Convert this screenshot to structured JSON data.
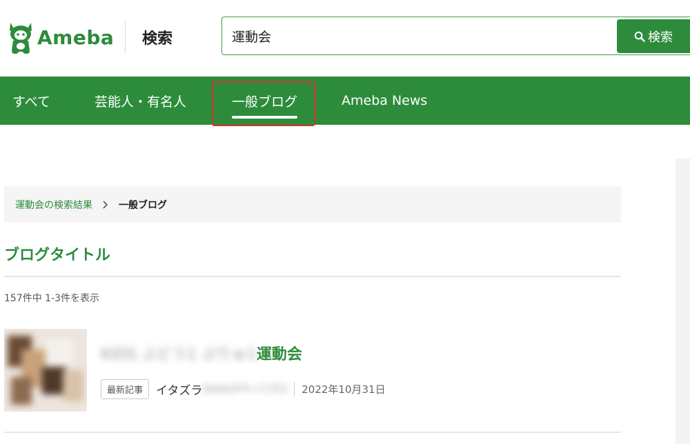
{
  "header": {
    "logo_text": "Ameba",
    "search_label": "検索",
    "search_value": "運動会",
    "search_button_label": "検索"
  },
  "nav": {
    "tabs": [
      {
        "label": "すべて"
      },
      {
        "label": "芸能人・有名人"
      },
      {
        "label": "一般ブログ",
        "active": true
      },
      {
        "label": "Ameba News"
      }
    ]
  },
  "breadcrumb": {
    "link": "運動会の検索結果",
    "current": "一般ブログ"
  },
  "section": {
    "title": "ブログタイトル",
    "result_count": "157件中 1-3件を表示"
  },
  "results": [
    {
      "title_blurred": "KIDS  ぶどう1  ぷりゅ1",
      "title_visible": "運動会",
      "badge": "最新記事",
      "author_visible": "イタズラ",
      "author_blurred": "おおおがやってきた",
      "date": "2022年10月31日"
    }
  ],
  "colors": {
    "brand_green": "#2d8c3c",
    "highlight_red": "#d9302c"
  },
  "icons": {
    "logo": "ameba-mascot-icon",
    "search": "search-icon",
    "breadcrumb_separator": "chevron-right-icon"
  }
}
